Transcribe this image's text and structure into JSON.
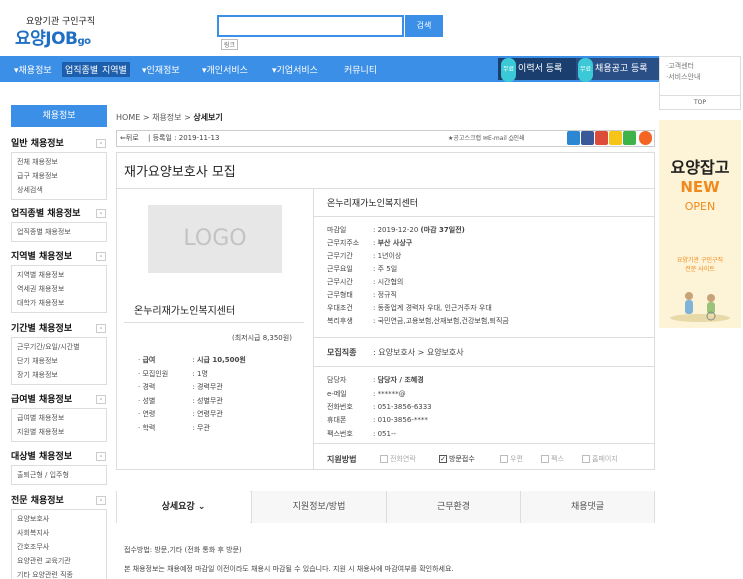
{
  "header": {
    "logo_sub": "요양기관 구인구직",
    "logo_main": "요양JOB",
    "logo_go": "go",
    "search_placeholder": "",
    "search_button": "검색",
    "site_link": "링크"
  },
  "nav": {
    "items": [
      {
        "label": "채용정보"
      },
      {
        "label": "업직종별"
      },
      {
        "label": "지역별"
      },
      {
        "label": "인재정보"
      },
      {
        "label": "개인서비스"
      },
      {
        "label": "기업서비스"
      },
      {
        "label": "커뮤니티"
      }
    ],
    "free_badge": "무료",
    "cta_resume": "이력서 등록",
    "cta_job": "채용공고 등록"
  },
  "right_side": {
    "links": [
      "고객센터",
      "서비스안내"
    ],
    "top": "TOP",
    "banner": {
      "line1": "요양잡고",
      "line2": "NEW",
      "line3": "OPEN",
      "line4": "요양기관 구인구직",
      "line5": "전문 사이트"
    }
  },
  "sidebar": {
    "title": "채용정보",
    "toggle": "-",
    "groups": [
      {
        "title": "일반 채용정보",
        "items": [
          "전체 채용정보",
          "급구 채용정보",
          "상세검색"
        ]
      },
      {
        "title": "업직종별 채용정보",
        "items": [
          "업직종별 채용정보"
        ]
      },
      {
        "title": "지역별 채용정보",
        "items": [
          "지역별 채용정보",
          "역세권 채용정보",
          "대학가 채용정보"
        ]
      },
      {
        "title": "기간별 채용정보",
        "items": [
          "근무기간/요일/시간별",
          "단기 채용정보",
          "장기 채용정보"
        ]
      },
      {
        "title": "급여별 채용정보",
        "items": [
          "급여별 채용정보",
          "지원별 채용정보"
        ]
      },
      {
        "title": "대상별 채용정보",
        "items": [
          "출퇴근형 / 입주형"
        ]
      },
      {
        "title": "전문 채용정보",
        "items": [
          "요양보호사",
          "사회복지사",
          "간호조무사",
          "요양관련 교육기관",
          "기타 요양관련 직종"
        ]
      }
    ]
  },
  "breadcrumb": {
    "home": "HOME",
    "sep": ">",
    "section": "채용정보",
    "current": "상세보기"
  },
  "toolbar": {
    "back": "뒤로",
    "reg_label": "등록일 : ",
    "reg_date": "2019-11-13",
    "scrap": "공고스크랩",
    "email": "E-mail",
    "print": "인쇄"
  },
  "job": {
    "title": "재가요양보호사 모집",
    "logo_placeholder": "LOGO",
    "company": "온누리재가노인복지센터",
    "min_wage": "(최저시급 8,350원)",
    "conditions": [
      {
        "key": "급여",
        "value": "시급 10,500원",
        "bold": true
      },
      {
        "key": "모집인원",
        "value": "1명"
      },
      {
        "key": "경력",
        "value": "경력무관"
      },
      {
        "key": "성별",
        "value": "성별무관"
      },
      {
        "key": "연령",
        "value": "연령무관"
      },
      {
        "key": "학력",
        "value": "무관"
      }
    ],
    "details": [
      {
        "key": "마감일",
        "value": "2019-12-20 ",
        "extra": "(마감 37일전)"
      },
      {
        "key": "근무지주소",
        "value": "부산 사상구",
        "bold": true
      },
      {
        "key": "근무기간",
        "value": "1년이상"
      },
      {
        "key": "근무요일",
        "value": "주 5일"
      },
      {
        "key": "근무시간",
        "value": "시간협의"
      },
      {
        "key": "근무형태",
        "value": "정규직"
      },
      {
        "key": "우대조건",
        "value": "동종업계 경력자 우대, 인근거주자 우대"
      },
      {
        "key": "복리후생",
        "value": "국민연금,고용보험,산재보험,건강보험,퇴직금"
      }
    ],
    "category_label": "모집직종",
    "category_value": "요양보호사 > 요양보호사",
    "contact": [
      {
        "key": "담당자",
        "value": "담당자 / 조혜경",
        "bold": true
      },
      {
        "key": "e-메일",
        "value": "******@"
      },
      {
        "key": "전화번호",
        "value": "051-3856-6333"
      },
      {
        "key": "휴대폰",
        "value": "010-3856-****"
      },
      {
        "key": "팩스번호",
        "value": "051--"
      }
    ],
    "apply_label": "지원방법",
    "apply_methods": [
      {
        "label": "전화연락",
        "checked": false
      },
      {
        "label": "방문접수",
        "checked": true
      },
      {
        "label": "우편",
        "checked": false
      },
      {
        "label": "팩스",
        "checked": false
      },
      {
        "label": "홈페이지",
        "checked": false
      }
    ]
  },
  "tabs": [
    "상세요강",
    "지원정보/방법",
    "근무환경",
    "채용댓글"
  ],
  "tab_arrow": "⌄",
  "info": {
    "line1": "접수방법: 방문,기타 (전화 통화 후 방문)",
    "line2": "본 채용정보는 채용예정 마감일 이전이라도 채용시 마감될 수 있습니다. 지원 시 채용사에 마감여부를 확인하세요."
  }
}
